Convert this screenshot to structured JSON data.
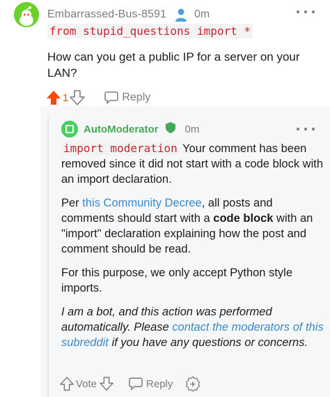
{
  "post_comment": {
    "username": "Embarrassed-Bus-8591",
    "time": "0m",
    "code": "from stupid_questions import *",
    "body": "How can you get a public IP for a server on your LAN?",
    "upvotes": "1",
    "reply_label": "Reply"
  },
  "mod_comment": {
    "username": "AutoModerator",
    "time": "0m",
    "code": "import moderation",
    "p1_rest": " Your comment has been removed since it did not start with a code block with an import declaration.",
    "p2_before": "Per ",
    "p2_link": "this Community Decree",
    "p2_mid": ", all posts and comments should start with a ",
    "p2_bold": "code block",
    "p2_after": " with an \"import\" declaration explaining how the post and comment should be read.",
    "p3": "For this purpose, we only accept Python style imports.",
    "p4_before": "I am a bot, and this action was performed automatically. Please ",
    "p4_link": "contact the moderators of this subreddit",
    "p4_after": " if you have any questions or concerns.",
    "vote_label": "Vote",
    "reply_label": "Reply"
  },
  "colors": {
    "upvote_active": "#ff4500",
    "mod_green": "#46a758",
    "link": "#3d88c8",
    "code_red": "#c4252e"
  },
  "icons": [
    "snoo-avatar-icon",
    "person-icon",
    "more-icon",
    "upvote-icon",
    "downvote-icon",
    "reply-icon",
    "moderator-shield-icon",
    "award-icon"
  ]
}
